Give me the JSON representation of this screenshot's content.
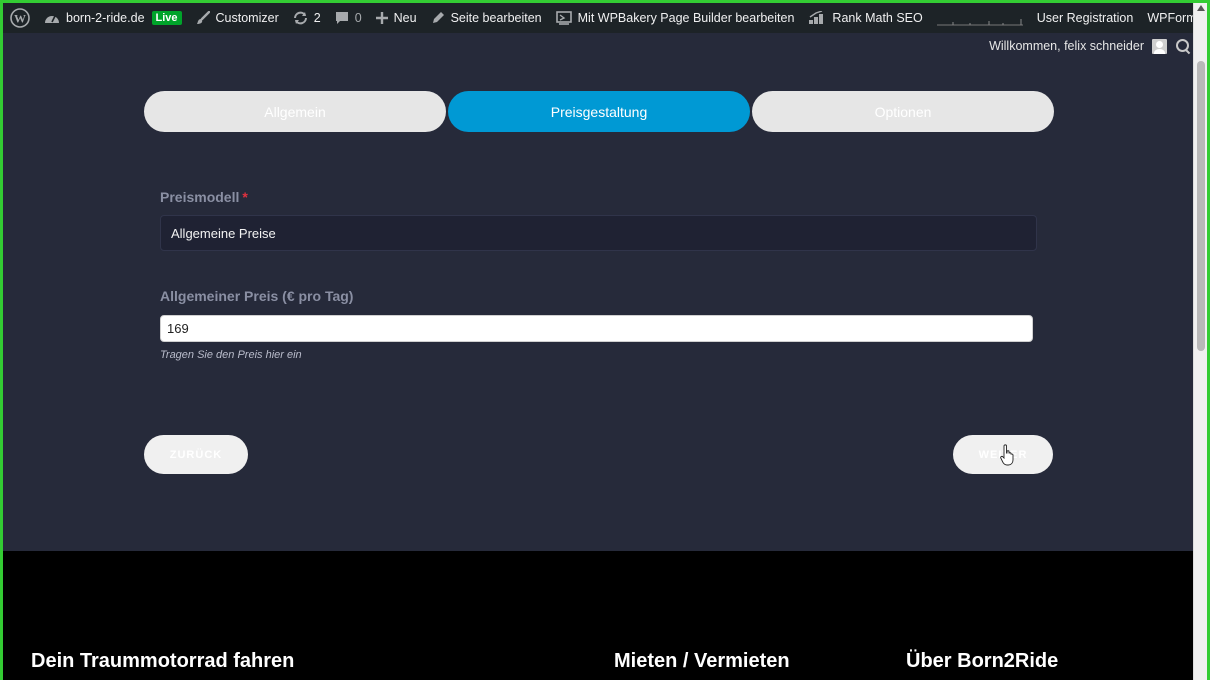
{
  "adminbar": {
    "site_name": "born-2-ride.de",
    "live_label": "Live",
    "customizer": "Customizer",
    "updates_count": "2",
    "comments_count": "0",
    "new_label": "Neu",
    "edit_page": "Seite bearbeiten",
    "wpbakery": "Mit WPBakery Page Builder bearbeiten",
    "rankmath": "Rank Math SEO",
    "user_registration": "User Registration",
    "wpforms": "WPForms"
  },
  "welcome": {
    "text": "Willkommen, felix schneider"
  },
  "steps": [
    {
      "label": "Allgemein",
      "active": false
    },
    {
      "label": "Preisgestaltung",
      "active": true
    },
    {
      "label": "Optionen",
      "active": false
    }
  ],
  "form": {
    "price_model_label": "Preismodell",
    "required_mark": "*",
    "price_model_value": "Allgemeine Preise",
    "general_price_label": "Allgemeiner Preis (€ pro Tag)",
    "general_price_value": "169",
    "general_price_hint": "Tragen Sie den Preis hier ein"
  },
  "nav": {
    "back_label": "ZURÜCK",
    "next_label": "WEITER"
  },
  "footer": {
    "col1_title": "Dein Traummotorrad fahren",
    "col2_title": "Mieten / Vermieten",
    "col3_title": "Über Born2Ride"
  },
  "colors": {
    "accent": "#0099d4",
    "frame": "#33cc33",
    "required": "#e0313f"
  }
}
